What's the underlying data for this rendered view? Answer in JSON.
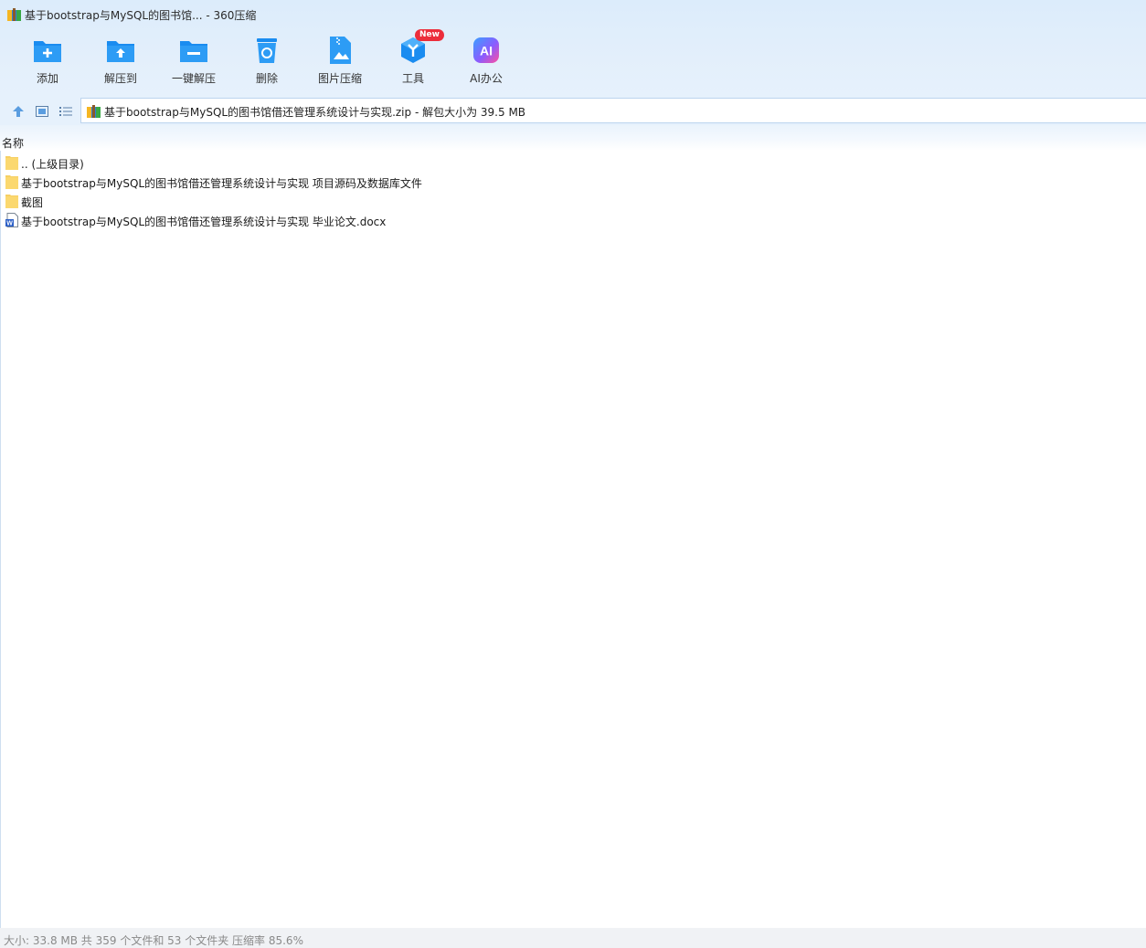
{
  "window": {
    "title": "基于bootstrap与MySQL的图书馆... - 360压缩"
  },
  "toolbar": {
    "items": [
      {
        "label": "添加",
        "icon": "add-folder-icon"
      },
      {
        "label": "解压到",
        "icon": "extract-to-icon"
      },
      {
        "label": "一键解压",
        "icon": "one-click-extract-icon"
      },
      {
        "label": "删除",
        "icon": "delete-bin-icon"
      },
      {
        "label": "图片压缩",
        "icon": "image-compress-icon"
      },
      {
        "label": "工具",
        "icon": "tools-cube-icon",
        "badge": "New"
      },
      {
        "label": "AI办公",
        "icon": "ai-office-icon"
      }
    ],
    "accent": "#1a8cf0",
    "badge_color": "#ec2d3b"
  },
  "address": {
    "text": "基于bootstrap与MySQL的图书馆借还管理系统设计与实现.zip - 解包大小为 39.5 MB"
  },
  "list": {
    "column_name": "名称",
    "rows": [
      {
        "name": ".. (上级目录)",
        "type": "folder"
      },
      {
        "name": "基于bootstrap与MySQL的图书馆借还管理系统设计与实现 项目源码及数据库文件",
        "type": "folder"
      },
      {
        "name": "截图",
        "type": "folder"
      },
      {
        "name": "基于bootstrap与MySQL的图书馆借还管理系统设计与实现 毕业论文.docx",
        "type": "word-document"
      }
    ]
  },
  "status": {
    "text": "大小: 33.8 MB 共 359 个文件和 53 个文件夹 压缩率 85.6%"
  }
}
